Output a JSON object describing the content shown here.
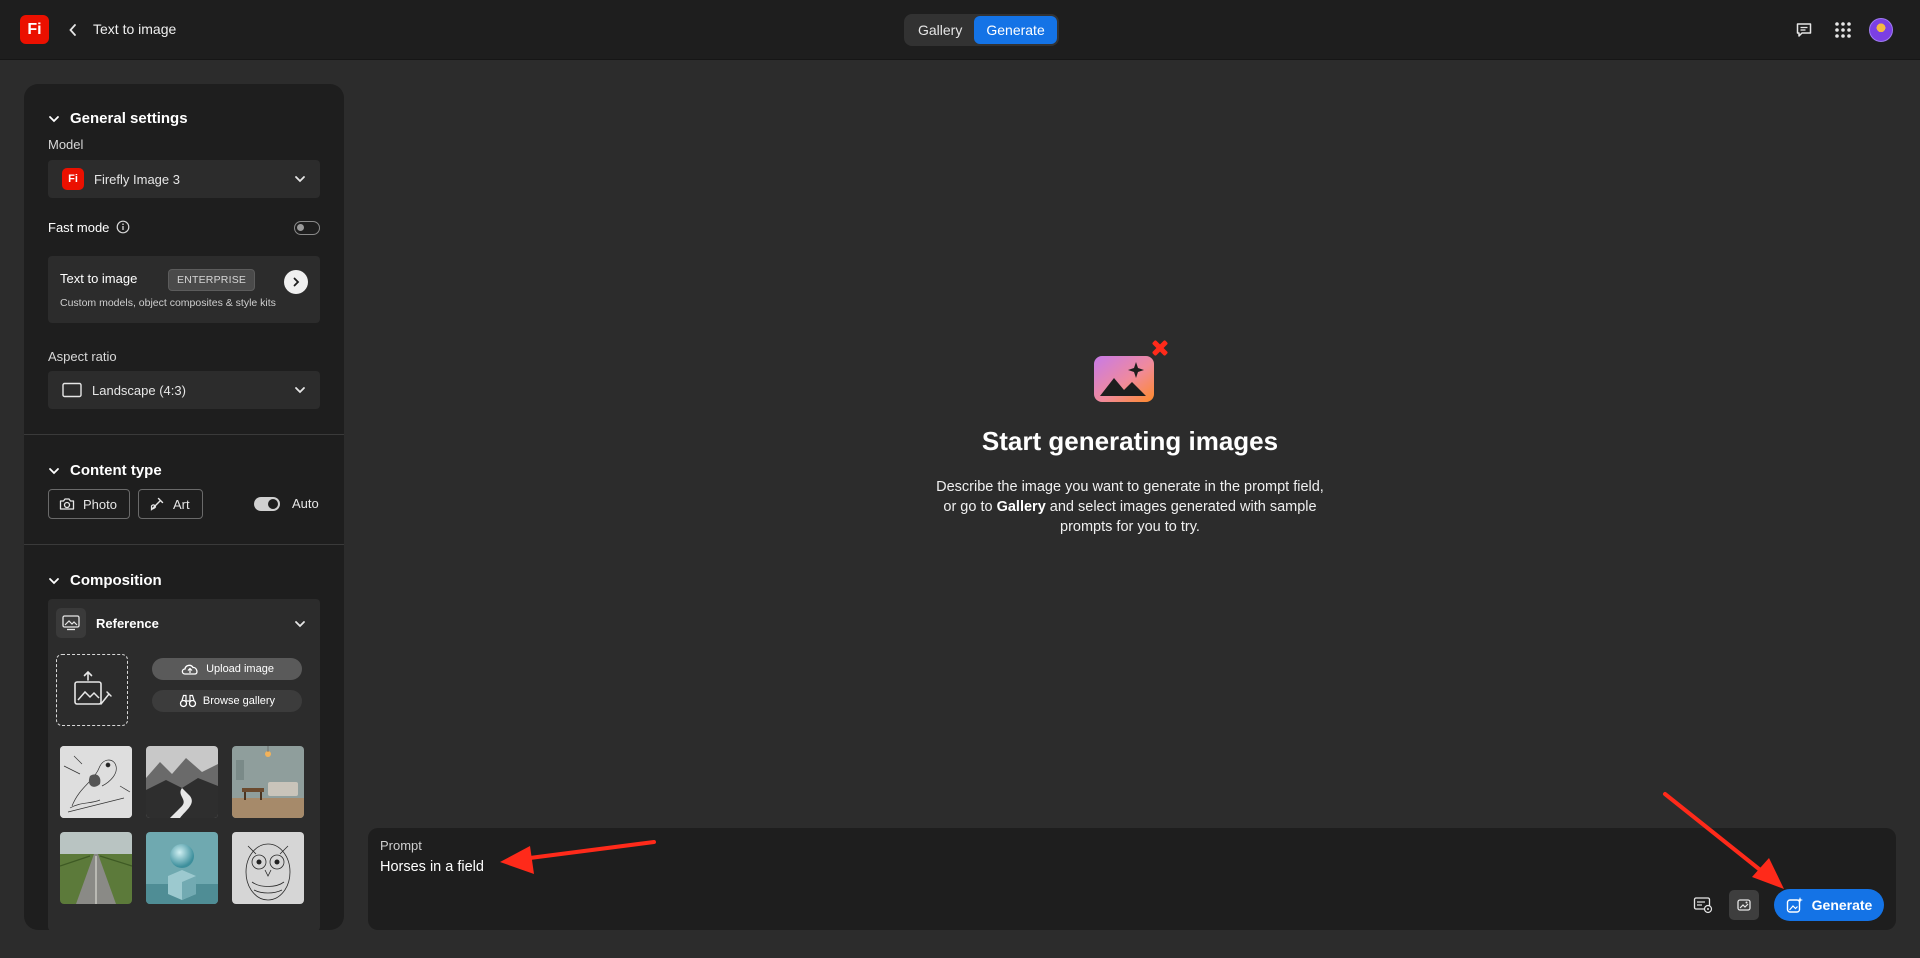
{
  "header": {
    "app_logo_text": "Fi",
    "page_title": "Text to image",
    "tabs": [
      {
        "label": "Gallery",
        "active": false
      },
      {
        "label": "Generate",
        "active": true
      }
    ]
  },
  "sidebar": {
    "general": {
      "title": "General settings",
      "model_label": "Model",
      "model_logo_text": "Fi",
      "model_value": "Firefly Image 3",
      "fast_mode_label": "Fast mode",
      "fast_mode_on": false,
      "promo_title": "Text to image",
      "promo_badge": "ENTERPRISE",
      "promo_sub": "Custom models, object composites & style kits",
      "aspect_label": "Aspect ratio",
      "aspect_value": "Landscape (4:3)"
    },
    "content_type": {
      "title": "Content type",
      "photo_label": "Photo",
      "art_label": "Art",
      "auto_label": "Auto",
      "auto_on": true
    },
    "composition": {
      "title": "Composition",
      "reference_title": "Reference",
      "upload_label": "Upload image",
      "browse_label": "Browse gallery"
    }
  },
  "main": {
    "empty_title": "Start generating images",
    "empty_desc_1": "Describe the image you want to generate in the prompt field, or go to ",
    "empty_desc_bold": "Gallery",
    "empty_desc_2": " and select images generated with sample prompts for you to try."
  },
  "prompt": {
    "label": "Prompt",
    "value": "Horses in a field",
    "generate_label": "Generate"
  },
  "colors": {
    "accent": "#1473e6",
    "brand": "#eb1000",
    "annotation": "#ff2a1a"
  }
}
